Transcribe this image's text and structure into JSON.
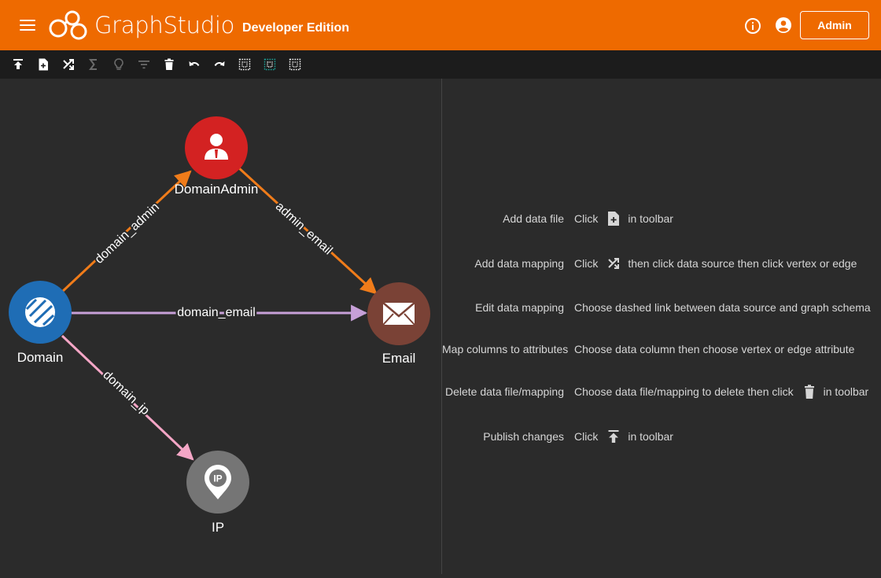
{
  "header": {
    "brand_name": "GraphStudio",
    "edition": "Developer Edition",
    "admin_button": "Admin",
    "bg_color": "#ee6a00"
  },
  "toolbar": {
    "buttons": [
      {
        "name": "publish",
        "icon": "publish-icon",
        "enabled": true
      },
      {
        "name": "add-data-file",
        "icon": "add-file-icon",
        "enabled": true
      },
      {
        "name": "map-data",
        "icon": "shuffle-icon",
        "enabled": true
      },
      {
        "name": "token-function",
        "icon": "sigma-icon",
        "enabled": false
      },
      {
        "name": "suggestion",
        "icon": "lightbulb-icon",
        "enabled": false
      },
      {
        "name": "filter",
        "icon": "filter-icon",
        "enabled": false
      },
      {
        "name": "delete",
        "icon": "trash-icon",
        "enabled": true
      },
      {
        "name": "undo",
        "icon": "undo-icon",
        "enabled": true
      },
      {
        "name": "redo",
        "icon": "redo-icon",
        "enabled": true
      },
      {
        "name": "select-all",
        "icon": "select-all-icon",
        "enabled": true
      },
      {
        "name": "select-vertices",
        "icon": "select-vertices-icon",
        "enabled": true
      },
      {
        "name": "select-edges",
        "icon": "select-edges-icon",
        "enabled": true
      }
    ]
  },
  "graph": {
    "vertices": [
      {
        "id": "DomainAdmin",
        "label": "DomainAdmin",
        "color": "#d32222",
        "icon": "user-icon"
      },
      {
        "id": "Domain",
        "label": "Domain",
        "color": "#1f6db5",
        "icon": "domain-icon"
      },
      {
        "id": "Email",
        "label": "Email",
        "color": "#7a4236",
        "icon": "envelope-icon"
      },
      {
        "id": "IP",
        "label": "IP",
        "color": "#757575",
        "icon": "ip-pin-icon"
      }
    ],
    "edges": [
      {
        "label": "domain_admin",
        "from": "Domain",
        "to": "DomainAdmin",
        "color": "#f07c1a"
      },
      {
        "label": "admin_email",
        "from": "DomainAdmin",
        "to": "Email",
        "color": "#f07c1a"
      },
      {
        "label": "domain_email",
        "from": "Domain",
        "to": "Email",
        "color": "#c7a0d8"
      },
      {
        "label": "domain_ip",
        "from": "Domain",
        "to": "IP",
        "color": "#f4a6c6"
      }
    ]
  },
  "help": {
    "rows": [
      {
        "label": "Add data file",
        "pre": "Click",
        "icon": "add-file-icon",
        "post": "in toolbar"
      },
      {
        "label": "Add data mapping",
        "pre": "Click",
        "icon": "shuffle-icon",
        "post": "then click data source then click vertex or edge"
      },
      {
        "label": "Edit data mapping",
        "pre": "Choose dashed link between data source and graph schema",
        "icon": "",
        "post": ""
      },
      {
        "label": "Map columns to attributes",
        "pre": "Choose data column then choose vertex or edge attribute",
        "icon": "",
        "post": ""
      },
      {
        "label": "Delete data file/mapping",
        "pre": "Choose data file/mapping to delete then click",
        "icon": "trash-icon",
        "post": "in toolbar"
      },
      {
        "label": "Publish changes",
        "pre": "Click",
        "icon": "publish-icon",
        "post": "in toolbar"
      }
    ]
  }
}
